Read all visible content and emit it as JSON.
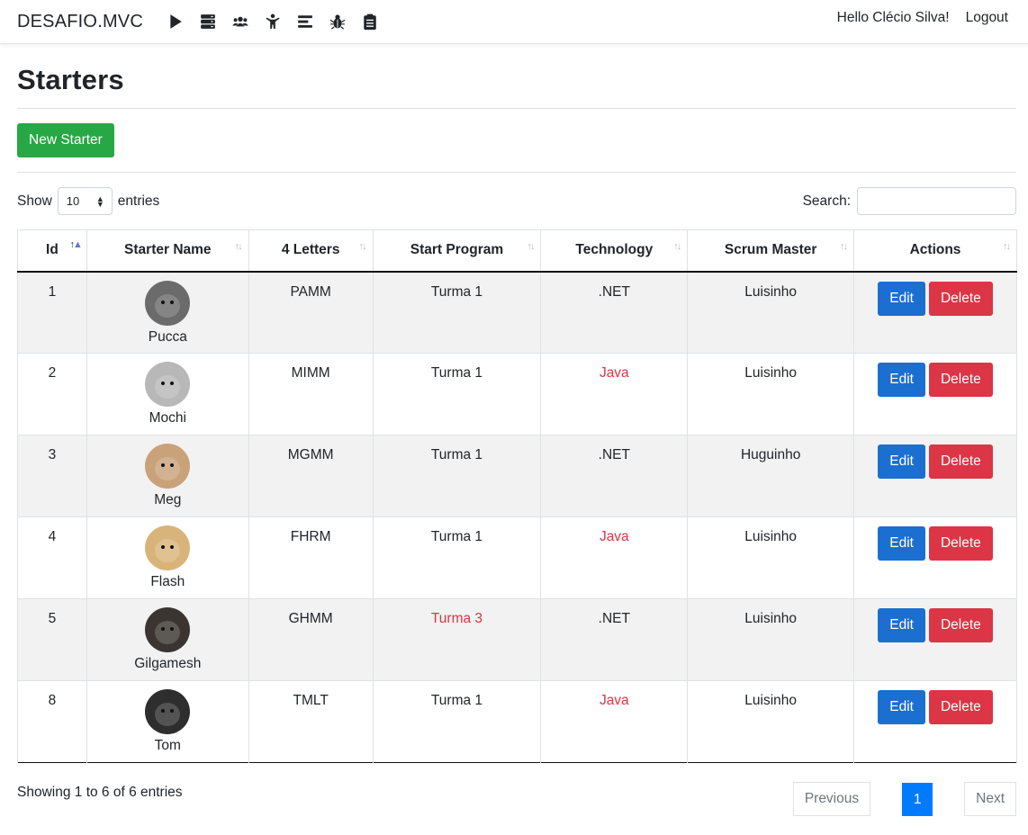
{
  "nav": {
    "brand": "DESAFIO.MVC",
    "icons": [
      "play-icon",
      "server-icon",
      "users-icon",
      "child-icon",
      "list-icon",
      "bug-icon",
      "clipboard-icon"
    ],
    "greeting": "Hello Clécio Silva!",
    "logout": "Logout"
  },
  "page": {
    "title": "Starters",
    "new_button": "New Starter"
  },
  "controls": {
    "show_label": "Show",
    "page_size": "10",
    "entries_label": "entries",
    "search_label": "Search:",
    "search_value": ""
  },
  "table": {
    "columns": [
      "Id",
      "Starter Name",
      "4 Letters",
      "Start Program",
      "Technology",
      "Scrum Master",
      "Actions"
    ],
    "edit_label": "Edit",
    "delete_label": "Delete",
    "rows": [
      {
        "id": "1",
        "name": "Pucca",
        "letters": "PAMM",
        "program": "Turma 1",
        "tech": ".NET",
        "master": "Luisinho",
        "photo_color": "#6b6b6b"
      },
      {
        "id": "2",
        "name": "Mochi",
        "letters": "MIMM",
        "program": "Turma 1",
        "tech": "Java",
        "master": "Luisinho",
        "photo_color": "#b8b8b8"
      },
      {
        "id": "3",
        "name": "Meg",
        "letters": "MGMM",
        "program": "Turma 1",
        "tech": ".NET",
        "master": "Huguinho",
        "photo_color": "#c9a27a"
      },
      {
        "id": "4",
        "name": "Flash",
        "letters": "FHRM",
        "program": "Turma 1",
        "tech": "Java",
        "master": "Luisinho",
        "photo_color": "#d8b47a"
      },
      {
        "id": "5",
        "name": "Gilgamesh",
        "letters": "GHMM",
        "program": "Turma 3",
        "tech": ".NET",
        "master": "Luisinho",
        "photo_color": "#3a3530"
      },
      {
        "id": "8",
        "name": "Tom",
        "letters": "TMLT",
        "program": "Turma 1",
        "tech": "Java",
        "master": "Luisinho",
        "photo_color": "#2e2e2e"
      }
    ]
  },
  "footer": {
    "info": "Showing 1 to 6 of 6 entries",
    "previous": "Previous",
    "current_page": "1",
    "next": "Next"
  },
  "colors": {
    "success": "#28a745",
    "primary": "#1a6fd0",
    "danger": "#dc3545",
    "page_active": "#007bff"
  }
}
